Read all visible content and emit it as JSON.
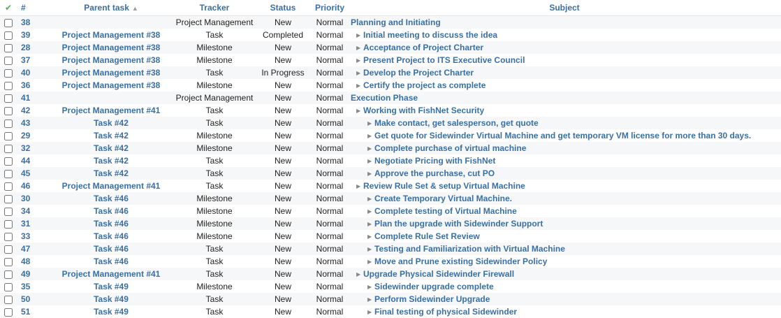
{
  "header": {
    "check": "✔",
    "id": "#",
    "parent": "Parent task",
    "tracker": "Tracker",
    "status": "Status",
    "priority": "Priority",
    "subject": "Subject"
  },
  "rows": [
    {
      "id": "38",
      "parent": "",
      "tracker": "Project Management",
      "status": "New",
      "priority": "Normal",
      "subject": "Planning and Initiating",
      "level": 0
    },
    {
      "id": "39",
      "parent": "Project Management #38",
      "tracker": "Task",
      "status": "Completed",
      "priority": "Normal",
      "subject": "Initial meeting to discuss the idea",
      "level": 1
    },
    {
      "id": "28",
      "parent": "Project Management #38",
      "tracker": "Milestone",
      "status": "New",
      "priority": "Normal",
      "subject": "Acceptance of Project Charter",
      "level": 1
    },
    {
      "id": "37",
      "parent": "Project Management #38",
      "tracker": "Milestone",
      "status": "New",
      "priority": "Normal",
      "subject": "Present Project to ITS Executive Council",
      "level": 1
    },
    {
      "id": "40",
      "parent": "Project Management #38",
      "tracker": "Task",
      "status": "In Progress",
      "priority": "Normal",
      "subject": "Develop the Project Charter",
      "level": 1
    },
    {
      "id": "36",
      "parent": "Project Management #38",
      "tracker": "Milestone",
      "status": "New",
      "priority": "Normal",
      "subject": "Certify the project as complete",
      "level": 1
    },
    {
      "id": "41",
      "parent": "",
      "tracker": "Project Management",
      "status": "New",
      "priority": "Normal",
      "subject": "Execution Phase",
      "level": 0
    },
    {
      "id": "42",
      "parent": "Project Management #41",
      "tracker": "Task",
      "status": "New",
      "priority": "Normal",
      "subject": "Working with FishNet Security",
      "level": 1
    },
    {
      "id": "43",
      "parent": "Task #42",
      "tracker": "Task",
      "status": "New",
      "priority": "Normal",
      "subject": "Make contact, get salesperson, get quote",
      "level": 2
    },
    {
      "id": "29",
      "parent": "Task #42",
      "tracker": "Milestone",
      "status": "New",
      "priority": "Normal",
      "subject": "Get quote for Sidewinder Virtual Machine and get temporary VM license for more than 30 days.",
      "level": 2
    },
    {
      "id": "32",
      "parent": "Task #42",
      "tracker": "Milestone",
      "status": "New",
      "priority": "Normal",
      "subject": "Complete purchase of virtual machine",
      "level": 2
    },
    {
      "id": "44",
      "parent": "Task #42",
      "tracker": "Task",
      "status": "New",
      "priority": "Normal",
      "subject": "Negotiate Pricing with FishNet",
      "level": 2
    },
    {
      "id": "45",
      "parent": "Task #42",
      "tracker": "Task",
      "status": "New",
      "priority": "Normal",
      "subject": "Approve the purchase, cut PO",
      "level": 2
    },
    {
      "id": "46",
      "parent": "Project Management #41",
      "tracker": "Task",
      "status": "New",
      "priority": "Normal",
      "subject": "Review Rule Set & setup Virtual Machine",
      "level": 1
    },
    {
      "id": "30",
      "parent": "Task #46",
      "tracker": "Milestone",
      "status": "New",
      "priority": "Normal",
      "subject": "Create Temporary Virtual Machine.",
      "level": 2
    },
    {
      "id": "34",
      "parent": "Task #46",
      "tracker": "Milestone",
      "status": "New",
      "priority": "Normal",
      "subject": "Complete testing of Virtual Machine",
      "level": 2
    },
    {
      "id": "31",
      "parent": "Task #46",
      "tracker": "Milestone",
      "status": "New",
      "priority": "Normal",
      "subject": "Plan the upgrade with Sidewinder Support",
      "level": 2
    },
    {
      "id": "33",
      "parent": "Task #46",
      "tracker": "Milestone",
      "status": "New",
      "priority": "Normal",
      "subject": "Complete Rule Set Review",
      "level": 2
    },
    {
      "id": "47",
      "parent": "Task #46",
      "tracker": "Task",
      "status": "New",
      "priority": "Normal",
      "subject": "Testing and Familiarization with Virtual Machine",
      "level": 2
    },
    {
      "id": "48",
      "parent": "Task #46",
      "tracker": "Task",
      "status": "New",
      "priority": "Normal",
      "subject": "Move and Prune existing Sidewinder Policy",
      "level": 2
    },
    {
      "id": "49",
      "parent": "Project Management #41",
      "tracker": "Task",
      "status": "New",
      "priority": "Normal",
      "subject": "Upgrade Physical Sidewinder Firewall",
      "level": 1
    },
    {
      "id": "35",
      "parent": "Task #49",
      "tracker": "Milestone",
      "status": "New",
      "priority": "Normal",
      "subject": "Sidewinder upgrade complete",
      "level": 2
    },
    {
      "id": "50",
      "parent": "Task #49",
      "tracker": "Task",
      "status": "New",
      "priority": "Normal",
      "subject": "Perform Sidewinder Upgrade",
      "level": 2
    },
    {
      "id": "51",
      "parent": "Task #49",
      "tracker": "Task",
      "status": "New",
      "priority": "Normal",
      "subject": "Final testing of physical Sidewinder",
      "level": 2
    }
  ]
}
